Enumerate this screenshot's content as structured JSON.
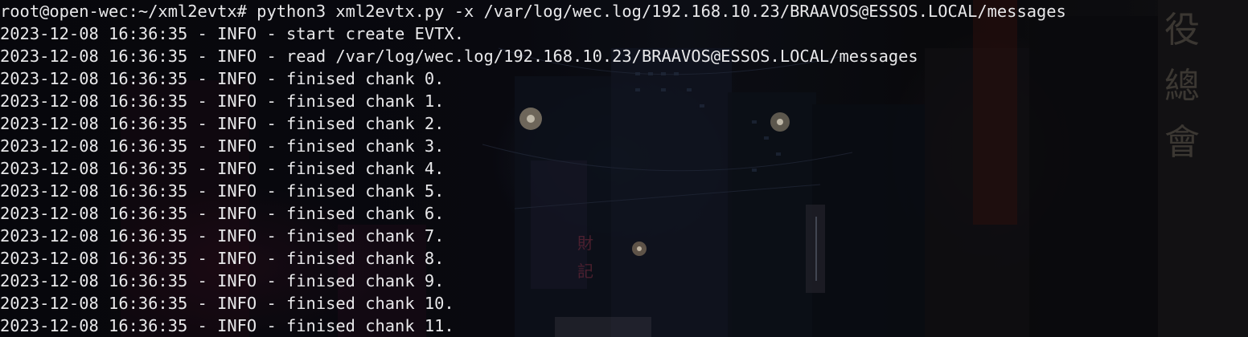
{
  "terminal": {
    "prompt": "root@open-wec:~/xml2evtx#",
    "command": " python3 xml2evtx.py -x /var/log/wec.log/192.168.10.23/BRAAVOS@ESSOS.LOCAL/messages",
    "lines": [
      "2023-12-08 16:36:35 - INFO - start create EVTX.",
      "2023-12-08 16:36:35 - INFO - read /var/log/wec.log/192.168.10.23/BRAAVOS@ESSOS.LOCAL/messages",
      "2023-12-08 16:36:35 - INFO - finised chank 0.",
      "2023-12-08 16:36:35 - INFO - finised chank 1.",
      "2023-12-08 16:36:35 - INFO - finised chank 2.",
      "2023-12-08 16:36:35 - INFO - finised chank 3.",
      "2023-12-08 16:36:35 - INFO - finised chank 4.",
      "2023-12-08 16:36:35 - INFO - finised chank 5.",
      "2023-12-08 16:36:35 - INFO - finised chank 6.",
      "2023-12-08 16:36:35 - INFO - finised chank 7.",
      "2023-12-08 16:36:35 - INFO - finised chank 8.",
      "2023-12-08 16:36:35 - INFO - finised chank 9.",
      "2023-12-08 16:36:35 - INFO - finised chank 10.",
      "2023-12-08 16:36:35 - INFO - finised chank 11."
    ]
  },
  "colors": {
    "text": "#e8e8ea",
    "background": "#0b0b10"
  },
  "background_image": "dark-neon-city-street-wallpaper",
  "wallpaper_glyphs": [
    "役",
    "總",
    "會",
    "財",
    "記"
  ]
}
